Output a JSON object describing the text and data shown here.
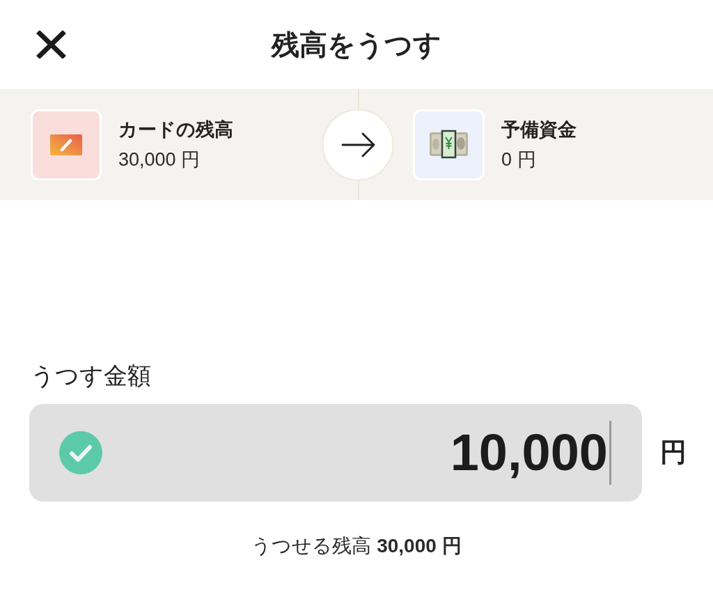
{
  "header": {
    "title": "残高をうつす"
  },
  "transfer": {
    "source": {
      "name": "カードの残高",
      "amount": "30,000 円"
    },
    "destination": {
      "name": "予備資金",
      "amount": "0 円"
    }
  },
  "amount": {
    "label": "うつす金額",
    "value": "10,000",
    "unit": "円",
    "valid": true,
    "focused": true
  },
  "available_balance": "うつせる残高 **30,000 円**"
}
